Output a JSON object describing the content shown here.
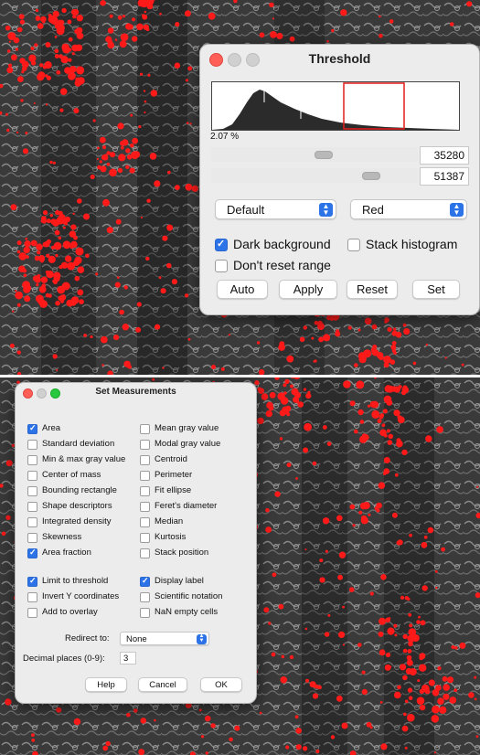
{
  "threshold": {
    "title": "Threshold",
    "percent": "2.07 %",
    "min_value": "35280",
    "max_value": "51387",
    "method": "Default",
    "display_mode": "Red",
    "dark_background": {
      "label": "Dark background",
      "checked": true
    },
    "stack_histogram": {
      "label": "Stack histogram",
      "checked": false
    },
    "dont_reset_range": {
      "label": "Don't reset range",
      "checked": false
    },
    "buttons": {
      "auto": "Auto",
      "apply": "Apply",
      "reset": "Reset",
      "set": "Set"
    },
    "colors": {
      "overlay": "#ff1a1a",
      "histogram": "#2b2b2b"
    }
  },
  "set_measurements": {
    "title": "Set Measurements",
    "left_column": [
      {
        "label": "Area",
        "checked": true
      },
      {
        "label": "Standard deviation",
        "checked": false
      },
      {
        "label": "Min & max gray value",
        "checked": false
      },
      {
        "label": "Center of mass",
        "checked": false
      },
      {
        "label": "Bounding rectangle",
        "checked": false
      },
      {
        "label": "Shape descriptors",
        "checked": false
      },
      {
        "label": "Integrated density",
        "checked": false
      },
      {
        "label": "Skewness",
        "checked": false
      },
      {
        "label": "Area fraction",
        "checked": true
      }
    ],
    "right_column": [
      {
        "label": "Mean gray value",
        "checked": false
      },
      {
        "label": "Modal gray value",
        "checked": false
      },
      {
        "label": "Centroid",
        "checked": false
      },
      {
        "label": "Perimeter",
        "checked": false
      },
      {
        "label": "Fit ellipse",
        "checked": false
      },
      {
        "label": "Feret's diameter",
        "checked": false
      },
      {
        "label": "Median",
        "checked": false
      },
      {
        "label": "Kurtosis",
        "checked": false
      },
      {
        "label": "Stack position",
        "checked": false
      }
    ],
    "options_left": [
      {
        "label": "Limit to threshold",
        "checked": true
      },
      {
        "label": "Invert Y coordinates",
        "checked": false
      },
      {
        "label": "Add to overlay",
        "checked": false
      }
    ],
    "options_right": [
      {
        "label": "Display label",
        "checked": true
      },
      {
        "label": "Scientific notation",
        "checked": false
      },
      {
        "label": "NaN empty cells",
        "checked": false
      }
    ],
    "redirect_label": "Redirect to:",
    "redirect_value": "None",
    "decimal_label": "Decimal places (0-9):",
    "decimal_value": "3",
    "buttons": {
      "help": "Help",
      "cancel": "Cancel",
      "ok": "OK"
    }
  }
}
